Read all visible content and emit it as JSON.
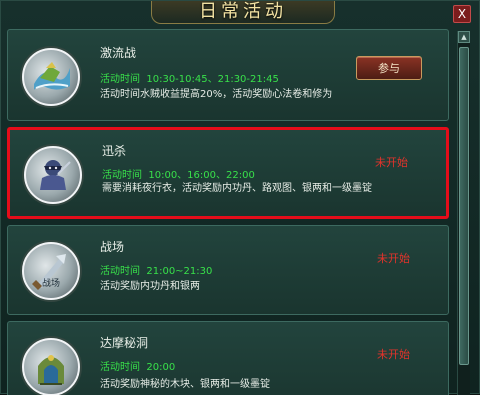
{
  "window": {
    "title": "日常活动",
    "close_label": "X"
  },
  "activities": [
    {
      "name": "激流战",
      "time_label": "活动时间",
      "time_value": "10:30-10:45、21:30-21:45",
      "description": "活动时间水贼收益提高20%，活动奖励心法卷和修为",
      "action_label": "参与",
      "status": "",
      "icon": "rapids-battle-icon"
    },
    {
      "name": "迅杀",
      "time_label": "活动时间",
      "time_value": "10:00、16:00、22:00",
      "description": "需要消耗夜行衣，活动奖励内功丹、路观图、银两和一级墨锭",
      "action_label": "",
      "status": "未开始",
      "icon": "assassin-icon"
    },
    {
      "name": "战场",
      "time_label": "活动时间",
      "time_value": "21:00~21:30",
      "description": "活动奖励内功丹和银两",
      "action_label": "",
      "status": "未开始",
      "icon": "battlefield-icon",
      "icon_label": "战场"
    },
    {
      "name": "达摩秘洞",
      "time_label": "活动时间",
      "time_value": "20:00",
      "description": "活动奖励神秘的木块、银两和一级墨锭",
      "action_label": "",
      "status": "未开始",
      "icon": "damo-cave-icon"
    }
  ],
  "colors": {
    "highlight_border": "#e40d1a",
    "time_green": "#38e04a",
    "status_red": "#e2332b"
  }
}
